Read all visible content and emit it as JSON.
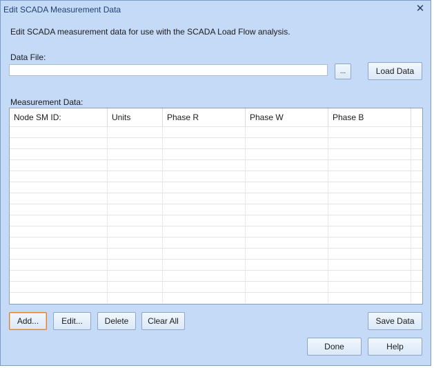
{
  "window": {
    "title": "Edit SCADA Measurement Data",
    "description": "Edit SCADA measurement data for use with the SCADA Load Flow analysis."
  },
  "data_file": {
    "label": "Data File:",
    "value": "",
    "browse_label": "...",
    "load_label": "Load Data"
  },
  "measurement": {
    "label": "Measurement Data:",
    "columns": [
      "Node SM ID:",
      "Units",
      "Phase R",
      "Phase W",
      "Phase B"
    ],
    "rows": []
  },
  "buttons": {
    "add": "Add...",
    "edit": "Edit...",
    "delete": "Delete",
    "clear_all": "Clear All",
    "save_data": "Save Data",
    "done": "Done",
    "help": "Help"
  },
  "icons": {
    "close": "close-icon"
  },
  "colors": {
    "window_bg": "#c4daf7",
    "title_text": "#1e3f73",
    "focus_border": "#d4823a"
  }
}
